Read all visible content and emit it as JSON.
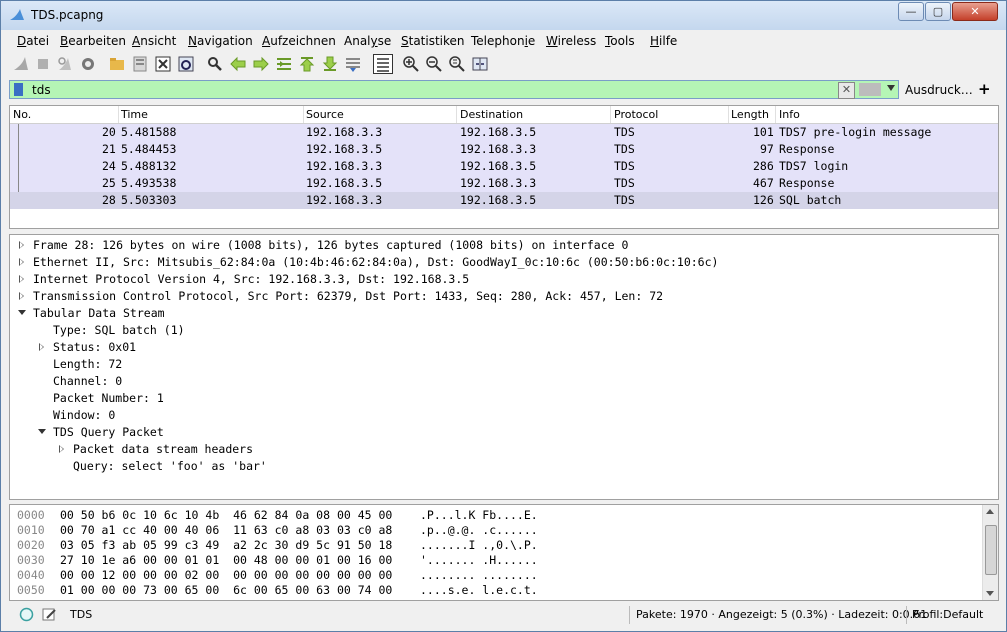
{
  "window": {
    "title": "TDS.pcapng"
  },
  "menu": [
    {
      "pre": "",
      "key": "D",
      "post": "atei"
    },
    {
      "pre": "",
      "key": "B",
      "post": "earbeiten"
    },
    {
      "pre": "",
      "key": "A",
      "post": "nsicht"
    },
    {
      "pre": "",
      "key": "N",
      "post": "avigation"
    },
    {
      "pre": "",
      "key": "A",
      "post": "ufzeichnen"
    },
    {
      "pre": "Anal",
      "key": "y",
      "post": "se"
    },
    {
      "pre": "",
      "key": "S",
      "post": "tatistiken"
    },
    {
      "pre": "Telephon",
      "key": "i",
      "post": "e"
    },
    {
      "pre": "",
      "key": "W",
      "post": "ireless"
    },
    {
      "pre": "",
      "key": "T",
      "post": "ools"
    },
    {
      "pre": "",
      "key": "H",
      "post": "ilfe"
    }
  ],
  "filter": {
    "value": "tds",
    "expression_label": "Ausdruck…",
    "add_label": "+"
  },
  "packet_list": {
    "columns": [
      "No.",
      "Time",
      "Source",
      "Destination",
      "Protocol",
      "Length",
      "Info"
    ],
    "rows": [
      {
        "no": "20",
        "time": "5.481588",
        "src": "192.168.3.3",
        "dst": "192.168.3.5",
        "proto": "TDS",
        "len": "101",
        "info": "TDS7 pre-login message"
      },
      {
        "no": "21",
        "time": "5.484453",
        "src": "192.168.3.5",
        "dst": "192.168.3.3",
        "proto": "TDS",
        "len": "97",
        "info": "Response"
      },
      {
        "no": "24",
        "time": "5.488132",
        "src": "192.168.3.3",
        "dst": "192.168.3.5",
        "proto": "TDS",
        "len": "286",
        "info": "TDS7 login"
      },
      {
        "no": "25",
        "time": "5.493538",
        "src": "192.168.3.5",
        "dst": "192.168.3.3",
        "proto": "TDS",
        "len": "467",
        "info": "Response"
      },
      {
        "no": "28",
        "time": "5.503303",
        "src": "192.168.3.3",
        "dst": "192.168.3.5",
        "proto": "TDS",
        "len": "126",
        "info": "SQL batch"
      }
    ]
  },
  "details": [
    "Frame 28: 126 bytes on wire (1008 bits), 126 bytes captured (1008 bits) on interface 0",
    "Ethernet II, Src: Mitsubis_62:84:0a (10:4b:46:62:84:0a), Dst: GoodWayI_0c:10:6c (00:50:b6:0c:10:6c)",
    "Internet Protocol Version 4, Src: 192.168.3.3, Dst: 192.168.3.5",
    "Transmission Control Protocol, Src Port: 62379, Dst Port: 1433, Seq: 280, Ack: 457, Len: 72",
    "Tabular Data Stream",
    "Type: SQL batch (1)",
    "Status: 0x01",
    "Length: 72",
    "Channel: 0",
    "Packet Number: 1",
    "Window: 0",
    "TDS Query Packet",
    "Packet data stream headers",
    "Query: select 'foo' as 'bar'"
  ],
  "hex": [
    {
      "off": "0000",
      "bytes": "00 50 b6 0c 10 6c 10 4b  46 62 84 0a 08 00 45 00",
      "ascii": ".P...l.K Fb....E."
    },
    {
      "off": "0010",
      "bytes": "00 70 a1 cc 40 00 40 06  11 63 c0 a8 03 03 c0 a8",
      "ascii": ".p..@.@. .c......"
    },
    {
      "off": "0020",
      "bytes": "03 05 f3 ab 05 99 c3 49  a2 2c 30 d9 5c 91 50 18",
      "ascii": ".......I .,0.\\.P."
    },
    {
      "off": "0030",
      "bytes": "27 10 1e a6 00 00 01 01  00 48 00 00 01 00 16 00",
      "ascii": "'....... .H......"
    },
    {
      "off": "0040",
      "bytes": "00 00 12 00 00 00 02 00  00 00 00 00 00 00 00 00",
      "ascii": "........ ........"
    },
    {
      "off": "0050",
      "bytes": "01 00 00 00 73 00 65 00  6c 00 65 00 63 00 74 00",
      "ascii": "....s.e. l.e.c.t."
    }
  ],
  "status": {
    "profile_name": "TDS",
    "packets": "Pakete: 1970 · Angezeigt: 5 (0.3%) · Ladezeit: 0:0.61",
    "profile": "Profil:Default"
  }
}
